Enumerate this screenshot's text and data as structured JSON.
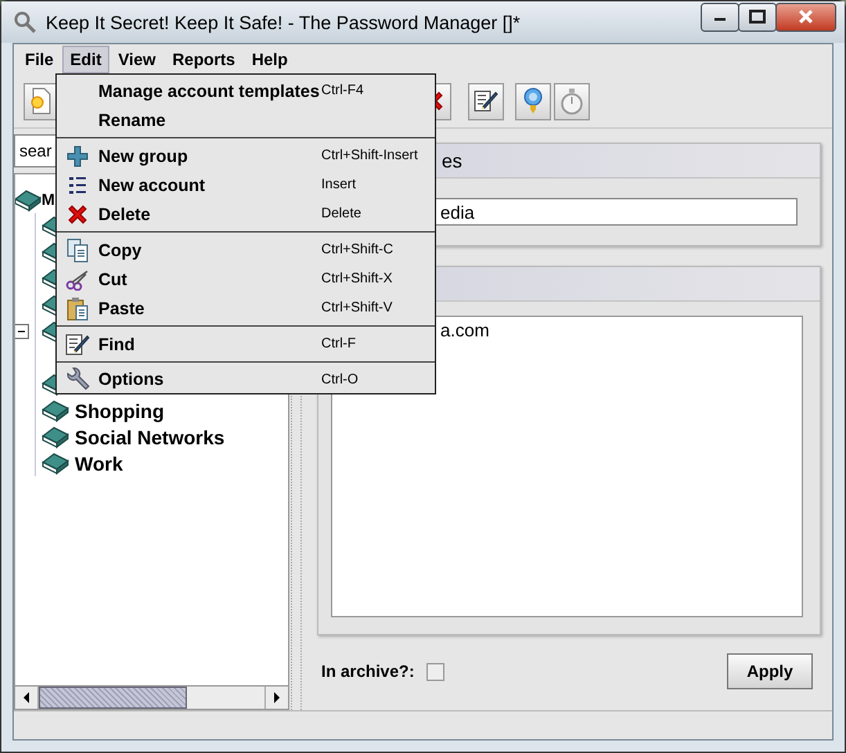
{
  "window": {
    "title": "Keep It Secret! Keep It Safe! - The Password Manager []*"
  },
  "menubar": [
    {
      "label": "File",
      "selected": false
    },
    {
      "label": "Edit",
      "selected": true
    },
    {
      "label": "View",
      "selected": false
    },
    {
      "label": "Reports",
      "selected": false
    },
    {
      "label": "Help",
      "selected": false
    }
  ],
  "toolbar": [
    {
      "kind": "new"
    },
    {
      "kind": "delete"
    },
    {
      "kind": "find"
    },
    {
      "kind": "hint"
    },
    {
      "kind": "timer"
    }
  ],
  "search": {
    "value": "sear"
  },
  "tree": {
    "label": "M",
    "children": [
      {
        "kind": "group"
      },
      {
        "kind": "group"
      },
      {
        "kind": "group"
      },
      {
        "kind": "group"
      },
      {
        "kind": "group",
        "expanded": true
      },
      {
        "kind": "group"
      },
      {
        "kind": "group",
        "label": "Shopping"
      },
      {
        "kind": "group",
        "label": "Social Networks"
      },
      {
        "kind": "group",
        "label": "Work"
      }
    ]
  },
  "details": {
    "name_panel": {
      "title": "es",
      "value": "edia"
    },
    "notes_panel": {
      "text": "a.com"
    },
    "archive": {
      "label": "In archive?:",
      "checked": false
    },
    "apply": "Apply"
  },
  "edit_menu": [
    {
      "kind": "templates",
      "label": "Manage account templates",
      "shortcut": "Ctrl-F4"
    },
    {
      "kind": "rename",
      "label": "Rename"
    },
    {
      "kind": "separator"
    },
    {
      "kind": "new_group",
      "label": "New group",
      "shortcut": "Ctrl+Shift-Insert"
    },
    {
      "kind": "new_account",
      "label": "New account",
      "shortcut": "Insert"
    },
    {
      "kind": "delete",
      "label": "Delete",
      "shortcut": "Delete"
    },
    {
      "kind": "separator"
    },
    {
      "kind": "copy",
      "label": "Copy",
      "shortcut": "Ctrl+Shift-C"
    },
    {
      "kind": "cut",
      "label": "Cut",
      "shortcut": "Ctrl+Shift-X"
    },
    {
      "kind": "paste",
      "label": "Paste",
      "shortcut": "Ctrl+Shift-V"
    },
    {
      "kind": "separator"
    },
    {
      "kind": "find",
      "label": "Find",
      "shortcut": "Ctrl-F"
    },
    {
      "kind": "separator"
    },
    {
      "kind": "options",
      "label": "Options",
      "shortcut": "Ctrl-O"
    }
  ]
}
